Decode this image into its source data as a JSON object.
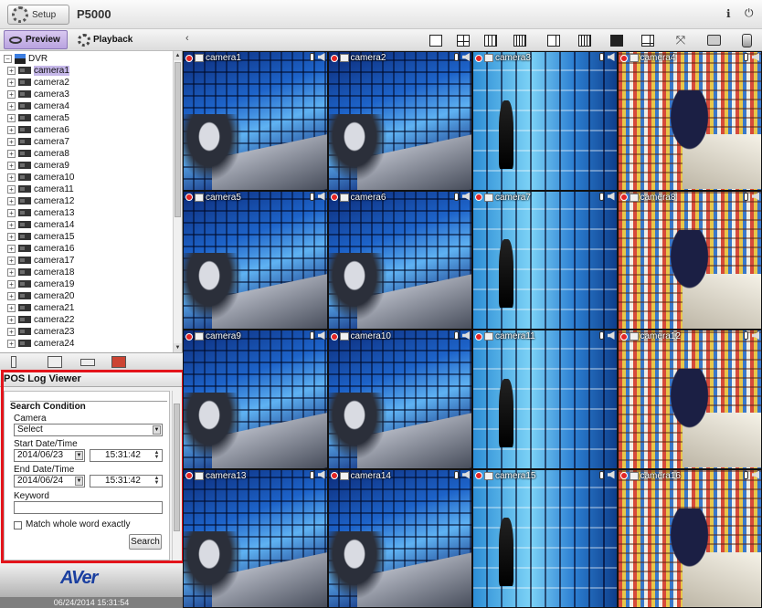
{
  "header": {
    "setup_label": "Setup",
    "product_name": "P5000"
  },
  "toolbar": {
    "preview_label": "Preview",
    "playback_label": "Playback",
    "collapse_glyph": "‹",
    "layout_icons": [
      "layout-1x1-icon",
      "layout-2x2-icon",
      "layout-3x3-icon",
      "layout-4x4-icon",
      "layout-side-icon",
      "layout-5x5-icon",
      "layout-full-icon",
      "layout-corner-icon",
      "fullscreen-icon",
      "snapshot-icon",
      "storage-icon"
    ]
  },
  "tree": {
    "root_label": "DVR",
    "selected_index": 0,
    "cameras": [
      "camera1",
      "camera2",
      "camera3",
      "camera4",
      "camera5",
      "camera6",
      "camera7",
      "camera8",
      "camera9",
      "camera10",
      "camera11",
      "camera12",
      "camera13",
      "camera14",
      "camera15",
      "camera16",
      "camera17",
      "camera18",
      "camera19",
      "camera20",
      "camera21",
      "camera22",
      "camera23",
      "camera24"
    ]
  },
  "pos_log": {
    "title": "POS Log Viewer",
    "section_title": "Search Condition",
    "camera_label": "Camera",
    "camera_value": "Select",
    "start_label": "Start Date/Time",
    "start_date": "2014/06/23",
    "start_time": "15:31:42",
    "end_label": "End Date/Time",
    "end_date": "2014/06/24",
    "end_time": "15:31:42",
    "keyword_label": "Keyword",
    "keyword_value": "",
    "match_label": "Match whole word exactly",
    "match_checked": false,
    "search_label": "Search"
  },
  "footer": {
    "logo_text": "AVer",
    "datetime": "06/24/2014 15:31:54"
  },
  "grid": {
    "tiles": [
      {
        "name": "camera1",
        "scene": "ctrl"
      },
      {
        "name": "camera2",
        "scene": "ctrl"
      },
      {
        "name": "camera3",
        "scene": "aisle"
      },
      {
        "name": "camera4",
        "scene": "store"
      },
      {
        "name": "camera5",
        "scene": "ctrl"
      },
      {
        "name": "camera6",
        "scene": "ctrl"
      },
      {
        "name": "camera7",
        "scene": "aisle"
      },
      {
        "name": "camera8",
        "scene": "store"
      },
      {
        "name": "camera9",
        "scene": "ctrl"
      },
      {
        "name": "camera10",
        "scene": "ctrl"
      },
      {
        "name": "camera11",
        "scene": "aisle"
      },
      {
        "name": "camera12",
        "scene": "store"
      },
      {
        "name": "camera13",
        "scene": "ctrl"
      },
      {
        "name": "camera14",
        "scene": "ctrl"
      },
      {
        "name": "camera15",
        "scene": "aisle"
      },
      {
        "name": "camera16",
        "scene": "store"
      }
    ]
  },
  "colors": {
    "selected_highlight": "#c6b8ea",
    "preview_active": "#b9a3e0",
    "highlight_frame": "#e3141b",
    "logo": "#1a3fa0"
  }
}
